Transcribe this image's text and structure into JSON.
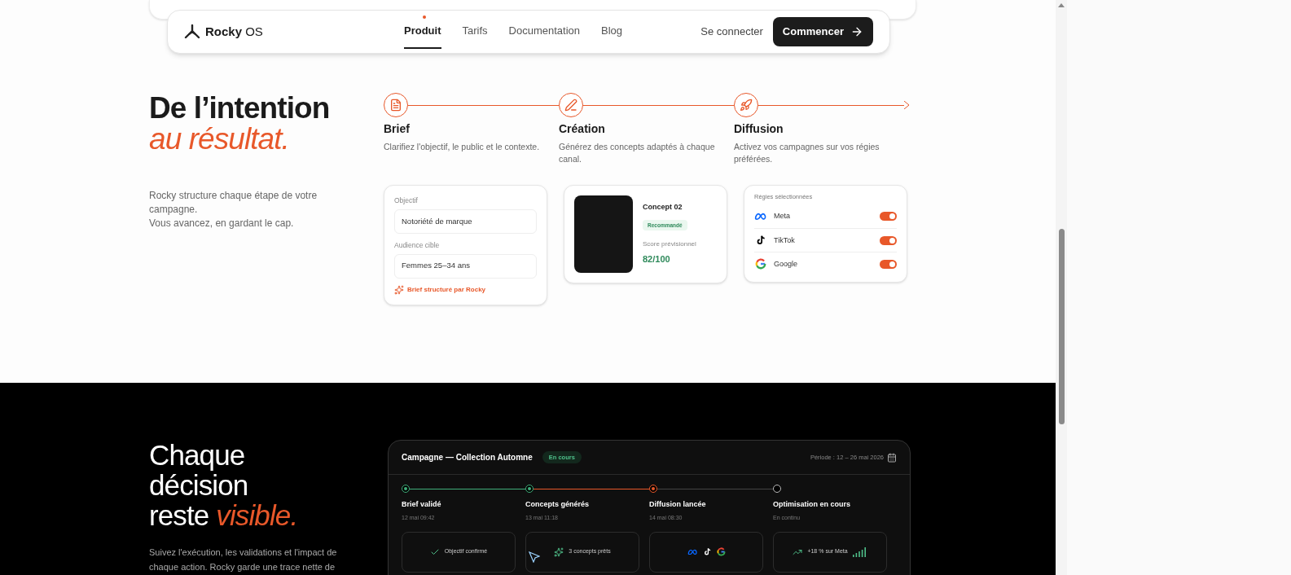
{
  "nav": {
    "logo": "Rocky",
    "logo_suffix": "OS",
    "links": [
      {
        "label": "Produit",
        "selected": true
      },
      {
        "label": "Tarifs",
        "selected": false
      },
      {
        "label": "Documentation",
        "selected": false
      },
      {
        "label": "Blog",
        "selected": false
      }
    ],
    "login": "Se connecter",
    "cta": "Commencer"
  },
  "process": {
    "title": "De l’intention",
    "title_accent": "au résultat.",
    "intro": [
      "Rocky structure chaque étape de votre campagne.",
      "Vous avancez, en gardant le cap."
    ],
    "steps": [
      {
        "kind": "brief",
        "title": "Brief",
        "text": "Clarifiez l'objectif, le public et le contexte."
      },
      {
        "kind": "creation",
        "title": "Création",
        "text": "Générez des concepts adaptés à chaque canal."
      },
      {
        "kind": "diffusion",
        "title": "Diffusion",
        "text": "Activez vos campagnes sur vos régies préférées."
      }
    ],
    "brief_card": {
      "fields": [
        {
          "label": "Objectif",
          "value": "Notoriété de marque"
        },
        {
          "label": "Audience cible",
          "value": "Femmes 25–34 ans"
        }
      ],
      "note": "Brief structuré par Rocky"
    },
    "concept_card": {
      "name": "Concept 02",
      "badge": "Recommandé",
      "score_label": "Score prévisionnel",
      "score": "82/100"
    },
    "channels_card": {
      "title": "Régies sélectionnées",
      "channels": [
        {
          "kind": "meta",
          "name": "Meta",
          "on": true
        },
        {
          "kind": "tiktok",
          "name": "TikTok",
          "on": true
        },
        {
          "kind": "google",
          "name": "Google",
          "on": true
        }
      ]
    }
  },
  "tracking": {
    "title": "Chaque décision reste",
    "title_accent": "visible.",
    "text": "Suivez l'exécution, les validations et l'impact de chaque action. Rocky garde une trace nette de",
    "panel": {
      "title": "Campagne — Collection Automne",
      "status": "En cours",
      "period": "Période : 12 – 26 mai 2026",
      "stages": [
        {
          "completed": true,
          "current": false,
          "title": "Brief validé",
          "date": "12 mai 09:42",
          "kind": "check",
          "result": "Objectif confirmé"
        },
        {
          "completed": true,
          "current": false,
          "title": "Concepts générés",
          "date": "13 mai 11:18",
          "kind": "sparkle",
          "result": "3 concepts prêts"
        },
        {
          "completed": false,
          "current": true,
          "title": "Diffusion lancée",
          "date": "14 mai 08:30",
          "kind": "logos"
        },
        {
          "completed": false,
          "current": false,
          "title": "Optimisation en cours",
          "date": "En continu",
          "kind": "trend",
          "result": "+18 % sur Meta"
        }
      ]
    }
  }
}
